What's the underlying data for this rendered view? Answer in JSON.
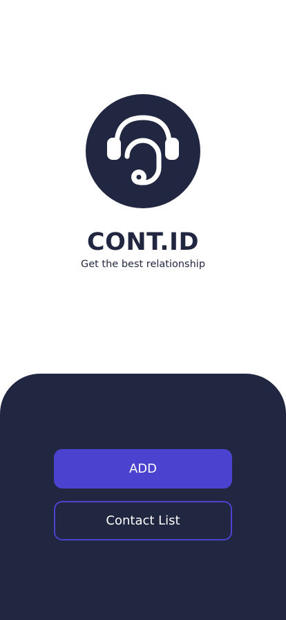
{
  "brand": {
    "title": "CONT.ID",
    "tagline": "Get the best relationship"
  },
  "logo": {
    "icon": "headset-icon"
  },
  "actions": {
    "add_label": "ADD",
    "contact_list_label": "Contact List"
  },
  "colors": {
    "navy": "#222741",
    "accent": "#4b42d0",
    "background": "#ffffff",
    "button_text": "#ffffff"
  }
}
